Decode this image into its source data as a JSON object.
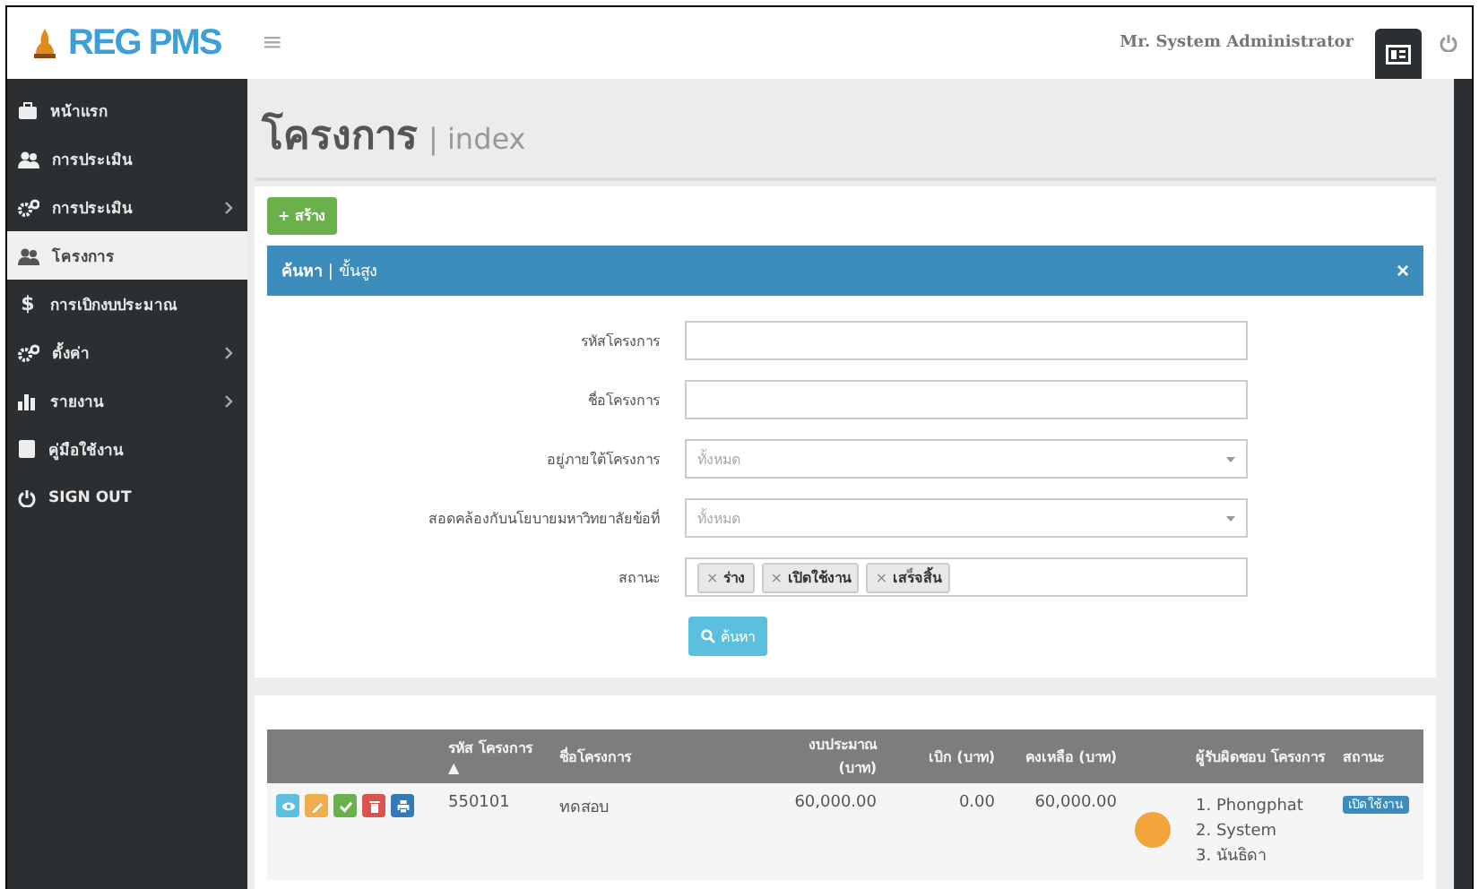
{
  "header": {
    "logo": "REG PMS",
    "menu_glyph": "≡",
    "user": "Mr. System Administrator"
  },
  "sidebar": {
    "items": [
      {
        "label": "หน้าแรก",
        "kind": "briefcase",
        "submenu": false,
        "selected": false
      },
      {
        "label": "การประเมิน",
        "kind": "group",
        "submenu": false,
        "selected": false
      },
      {
        "label": "การประเมิน",
        "kind": "cogs",
        "submenu": true,
        "selected": false
      },
      {
        "label": "โครงการ",
        "kind": "group",
        "submenu": false,
        "selected": true
      },
      {
        "label": "การเบิกงบประมาณ",
        "kind": "glyph",
        "glyph": "$",
        "submenu": false,
        "selected": false
      },
      {
        "label": "ตั้งค่า",
        "kind": "cogs",
        "submenu": true,
        "selected": false
      },
      {
        "label": "รายงาน",
        "kind": "chart",
        "submenu": true,
        "selected": false
      },
      {
        "label": "คู่มือใช้งาน",
        "kind": "book",
        "submenu": false,
        "selected": false
      },
      {
        "label": "SIGN OUT",
        "kind": "power",
        "submenu": false,
        "selected": false
      }
    ]
  },
  "page": {
    "title": "โครงการ",
    "subtitle": "| index"
  },
  "create_button": {
    "label": "สร้าง",
    "glyph": "+"
  },
  "search_panel": {
    "title": "**ค้นหา** | ขั้นสูง",
    "close_glyph": "×",
    "fields": [
      {
        "kind": "text",
        "label": "รหัสโครงการ"
      },
      {
        "kind": "text",
        "label": "ชื่อโครงการ"
      },
      {
        "kind": "select",
        "label": "อยู่ภายใต้โครงการ",
        "placeholder": "ทั้งหมด"
      },
      {
        "kind": "select",
        "label": "สอดคล้องกับนโยบายมหาวิทยาลัยข้อที่",
        "placeholder": "ทั้งหมด"
      },
      {
        "kind": "tags",
        "label": "สถานะ",
        "remove_glyph": "×",
        "tags": [
          "ร่าง",
          "เปิดใช้งาน",
          "เสร็จสิ้น"
        ]
      }
    ],
    "button": "ค้นหา"
  },
  "table": {
    "columns": [
      {},
      {
        "label": "รหัส โครงการ",
        "sort_glyph": "▲"
      },
      {
        "label": "ชื่อโครงการ"
      },
      {
        "label": "งบประมาณ (บาท)"
      },
      {
        "label": "เบิก (บาท)"
      },
      {
        "label": "คงเหลือ (บาท)"
      },
      {},
      {
        "label": "ผู้รับผิดชอบ โครงการ"
      },
      {
        "label": "สถานะ"
      }
    ],
    "rows": [
      {
        "actions": [
          {
            "kind": "view"
          },
          {
            "kind": "edit"
          },
          {
            "kind": "approve"
          },
          {
            "kind": "delete"
          },
          {
            "kind": "print"
          }
        ],
        "code": "550101",
        "name": "ทดสอบ",
        "budget": "60,000.00",
        "spent": "0.00",
        "remaining": "60,000.00",
        "color": "#f2a33a",
        "owners": [
          "1. Phongphat",
          "2. System",
          "3. นันธิดา"
        ],
        "status": "เปิดใช้งาน"
      }
    ]
  }
}
